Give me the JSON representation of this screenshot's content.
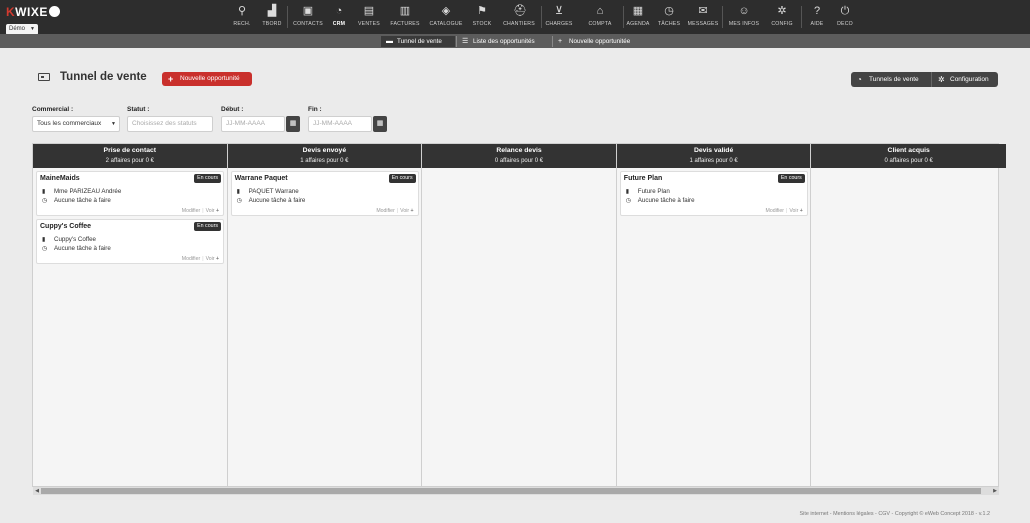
{
  "app": {
    "logo_mark": "K",
    "logo_text": "WIXE",
    "account": "Démo"
  },
  "menu": [
    {
      "id": "rech",
      "label": "RECH.",
      "icon": "search-icon",
      "glyph": "⚲"
    },
    {
      "id": "tbord",
      "label": "TBORD",
      "icon": "chart-area-icon",
      "glyph": "▟"
    },
    {
      "id": "contacts",
      "label": "CONTACTS",
      "icon": "address-book-icon",
      "glyph": "▣"
    },
    {
      "id": "crm",
      "label": "CRM",
      "icon": "dashboard-icon",
      "glyph": "◔",
      "active": true
    },
    {
      "id": "ventes",
      "label": "VENTES",
      "icon": "document-icon",
      "glyph": "▤"
    },
    {
      "id": "factures",
      "label": "FACTURES",
      "icon": "invoice-icon",
      "glyph": "▥"
    },
    {
      "id": "catalogue",
      "label": "CATALOGUE",
      "icon": "tags-icon",
      "glyph": "◈"
    },
    {
      "id": "stock",
      "label": "STOCK",
      "icon": "stock-icon",
      "glyph": "⚑"
    },
    {
      "id": "chantiers",
      "label": "CHANTIERS",
      "icon": "worker-icon",
      "glyph": "⛑"
    },
    {
      "id": "charges",
      "label": "CHARGES",
      "icon": "cart-icon",
      "glyph": "⊻"
    },
    {
      "id": "compta",
      "label": "COMPTA",
      "icon": "bank-icon",
      "glyph": "⌂"
    },
    {
      "id": "agenda",
      "label": "AGENDA",
      "icon": "calendar-icon",
      "glyph": "▦"
    },
    {
      "id": "taches",
      "label": "TÂCHES",
      "icon": "stopwatch-icon",
      "glyph": "◷"
    },
    {
      "id": "messages",
      "label": "MESSAGES",
      "icon": "envelope-icon",
      "glyph": "✉"
    },
    {
      "id": "mesinfos",
      "label": "MES INFOS",
      "icon": "user-icon",
      "glyph": "☺"
    },
    {
      "id": "config",
      "label": "CONFIG",
      "icon": "gear-icon",
      "glyph": "✲"
    },
    {
      "id": "aide",
      "label": "AIDE",
      "icon": "help-icon",
      "glyph": "?"
    },
    {
      "id": "deco",
      "label": "DECO",
      "icon": "power-icon",
      "glyph": "⏻"
    }
  ],
  "subnav": [
    {
      "label": "Tunnel de vente",
      "icon": "funnel-icon",
      "glyph": "▬",
      "current": true
    },
    {
      "label": "Liste des opportunités",
      "icon": "list-icon",
      "glyph": "☰"
    },
    {
      "label": "Nouvelle opportunitée",
      "icon": "plus-icon",
      "glyph": "+"
    }
  ],
  "page": {
    "title": "Tunnel de vente",
    "new_button": "Nouvelle opportunité",
    "tunnels_button": "Tunnels de vente",
    "config_button": "Configuration"
  },
  "filters": {
    "commercial_label": "Commercial :",
    "commercial_value": "Tous les commerciaux",
    "statut_label": "Statut :",
    "statut_placeholder": "Choisissez des statuts",
    "debut_label": "Début :",
    "debut_placeholder": "JJ-MM-AAAA",
    "fin_label": "Fin :",
    "fin_placeholder": "JJ-MM-AAAA"
  },
  "card_actions": {
    "edit": "Modifier",
    "view": "Voir"
  },
  "columns": [
    {
      "title": "Prise de contact",
      "summary": "2 affaires pour 0 €",
      "cards": [
        {
          "name": "MaineMaids",
          "status": "En cours",
          "contact": "Mme PARIZEAU Andrée",
          "tasks": "Aucune tâche à faire"
        },
        {
          "name": "Cuppy's Coffee",
          "status": "En cours",
          "contact": "Cuppy's Coffee",
          "tasks": "Aucune tâche à faire"
        }
      ]
    },
    {
      "title": "Devis envoyé",
      "summary": "1 affaires pour 0 €",
      "cards": [
        {
          "name": "Warrane Paquet",
          "status": "En cours",
          "contact": "PAQUET Warrane",
          "tasks": "Aucune tâche à faire"
        }
      ]
    },
    {
      "title": "Relance devis",
      "summary": "0 affaires pour 0 €",
      "cards": []
    },
    {
      "title": "Devis validé",
      "summary": "1 affaires pour 0 €",
      "cards": [
        {
          "name": "Future Plan",
          "status": "En cours",
          "contact": "Future Plan",
          "tasks": "Aucune tâche à faire"
        }
      ]
    },
    {
      "title": "Client acquis",
      "summary": "0 affaires pour 0 €",
      "cards": []
    }
  ],
  "footer": "Site internet - Mentions légales - CGV - Copyright © eWeb Concept 2018 - v.1.2"
}
